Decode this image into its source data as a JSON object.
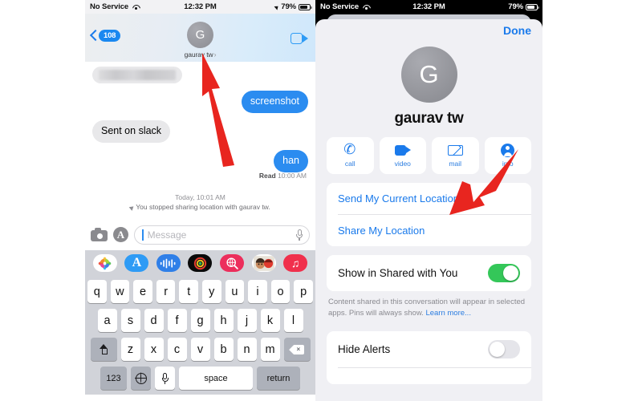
{
  "left_phone": {
    "status_bar": {
      "carrier": "No Service",
      "wifi_icon": "wifi-icon",
      "time": "12:32 PM",
      "location_icon": "location-arrow-icon",
      "battery": "79%",
      "battery_icon": "battery-icon"
    },
    "nav": {
      "back_icon": "chevron-left-icon",
      "unread_count": "108",
      "avatar_initial": "G",
      "contact_name": "gaurav tw",
      "chevron": "›",
      "facetime_icon": "video-camera-icon"
    },
    "messages": [
      {
        "type": "incoming-redacted",
        "text": ""
      },
      {
        "type": "outgoing",
        "text": "screenshot"
      },
      {
        "type": "incoming",
        "text": "Sent on slack"
      },
      {
        "type": "outgoing",
        "text": "han"
      }
    ],
    "read_receipt": {
      "label": "Read",
      "time": "10:00 AM"
    },
    "system_message": {
      "timestamp": "Today, 10:01 AM",
      "icon": "location-arrow-icon",
      "text": "You stopped sharing location with gaurav tw."
    },
    "input_bar": {
      "camera_icon": "camera-icon",
      "appstore_icon": "app-store-icon",
      "placeholder": "Message",
      "value": "",
      "mic_icon": "microphone-icon"
    },
    "app_drawer": [
      {
        "name": "photos-app-icon",
        "glyph": "❀"
      },
      {
        "name": "app-store-app-icon",
        "glyph": "A"
      },
      {
        "name": "digital-touch-app-icon",
        "glyph": ""
      },
      {
        "name": "apple-music-app-icon",
        "glyph": ""
      },
      {
        "name": "images-search-app-icon",
        "glyph": ""
      },
      {
        "name": "memoji-app-icon",
        "glyph": ""
      },
      {
        "name": "music-app-icon",
        "glyph": "♫"
      }
    ],
    "keyboard": {
      "row1": [
        "q",
        "w",
        "e",
        "r",
        "t",
        "y",
        "u",
        "i",
        "o",
        "p"
      ],
      "row2": [
        "a",
        "s",
        "d",
        "f",
        "g",
        "h",
        "j",
        "k",
        "l"
      ],
      "row3": [
        "z",
        "x",
        "c",
        "v",
        "b",
        "n",
        "m"
      ],
      "shift_icon": "shift-icon",
      "delete_icon": "backspace-icon",
      "numbers_key": "123",
      "globe_icon": "globe-icon",
      "dictation_icon": "microphone-icon",
      "space_key": "space",
      "return_key": "return"
    }
  },
  "right_phone": {
    "status_bar": {
      "carrier": "No Service",
      "wifi_icon": "wifi-icon",
      "time": "12:32 PM",
      "battery": "79%",
      "battery_icon": "battery-icon"
    },
    "done_label": "Done",
    "contact": {
      "avatar_initial": "G",
      "name": "gaurav tw"
    },
    "actions": [
      {
        "label": "call",
        "icon": "phone-icon"
      },
      {
        "label": "video",
        "icon": "video-camera-icon"
      },
      {
        "label": "mail",
        "icon": "envelope-icon"
      },
      {
        "label": "info",
        "icon": "person-info-icon"
      }
    ],
    "location_rows": [
      {
        "label": "Send My Current Location"
      },
      {
        "label": "Share My Location"
      }
    ],
    "shared_with_you": {
      "label": "Show in Shared with You",
      "state": "on"
    },
    "footnote": {
      "text": "Content shared in this conversation will appear in selected apps. Pins will always show.",
      "link": "Learn more..."
    },
    "hide_alerts": {
      "label": "Hide Alerts",
      "state": "off"
    }
  },
  "annotations": {
    "arrow_left": {
      "color": "#e8251f",
      "points_to": "contact-name-nav"
    },
    "arrow_right": {
      "color": "#e8251f",
      "points_to": "send-my-current-location"
    }
  },
  "colors": {
    "accent_blue": "#1a7aeb",
    "bubble_blue": "#2b8cf0",
    "bubble_gray": "#e8e8ea",
    "toggle_green": "#34c759",
    "arrow_red": "#e8251f"
  }
}
